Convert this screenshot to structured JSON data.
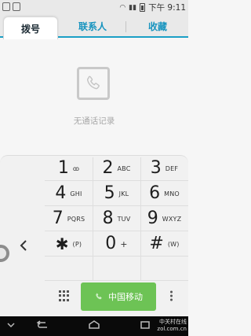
{
  "status": {
    "time": "下午 9:11"
  },
  "tabs": [
    {
      "label": "拨号",
      "active": true
    },
    {
      "label": "联系人",
      "active": false
    },
    {
      "label": "收藏",
      "active": false
    }
  ],
  "empty_state": {
    "message": "无通话记录"
  },
  "keys": [
    {
      "digit": "1",
      "letters": "ꝏ"
    },
    {
      "digit": "2",
      "letters": "ABC"
    },
    {
      "digit": "3",
      "letters": "DEF"
    },
    {
      "digit": "4",
      "letters": "GHI"
    },
    {
      "digit": "5",
      "letters": "JKL"
    },
    {
      "digit": "6",
      "letters": "MNO"
    },
    {
      "digit": "7",
      "letters": "PQRS"
    },
    {
      "digit": "8",
      "letters": "TUV"
    },
    {
      "digit": "9",
      "letters": "WXYZ"
    },
    {
      "digit": "✱",
      "letters": "(P)"
    },
    {
      "digit": "0",
      "letters": "+"
    },
    {
      "digit": "#",
      "letters": "(W)"
    }
  ],
  "call_button": {
    "label": "中国移动"
  },
  "watermark": {
    "line1": "中关村在线",
    "line2": "zol.com.cn"
  },
  "colors": {
    "accent": "#1b9fc6",
    "call_green": "#6dc355"
  }
}
